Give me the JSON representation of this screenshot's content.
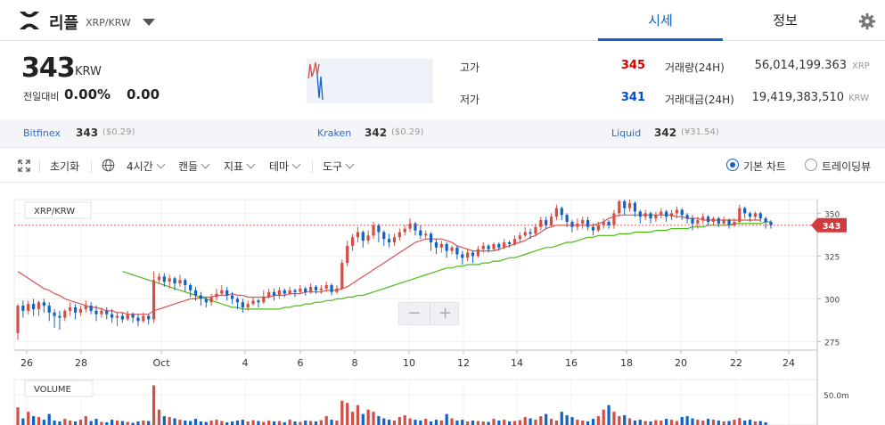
{
  "header": {
    "coin_name": "리플",
    "pair": "XRP/KRW",
    "tabs": [
      {
        "label": "시세"
      },
      {
        "label": "정보"
      }
    ]
  },
  "summary": {
    "price": "343",
    "unit": "KRW",
    "change_label": "전일대비",
    "change_pct": "0.00%",
    "change_value": "0.00",
    "high_label": "고가",
    "high_value": "345",
    "low_label": "저가",
    "low_value": "341",
    "volume_label": "거래량(24H)",
    "volume_value": "56,014,199.363",
    "volume_unit": "XRP",
    "amount_label": "거래대금(24H)",
    "amount_value": "19,419,383,510",
    "amount_unit": "KRW"
  },
  "exchanges": [
    {
      "name": "Bitfinex",
      "price": "343",
      "fx": "($0.29)"
    },
    {
      "name": "Kraken",
      "price": "342",
      "fx": "($0.29)"
    },
    {
      "name": "Liquid",
      "price": "342",
      "fx": "(¥31.54)"
    }
  ],
  "toolbar": {
    "reset": "초기화",
    "interval": "4시간",
    "candle": "캔들",
    "indicator": "지표",
    "theme": "테마",
    "tools": "도구",
    "basic_chart": "기본 차트",
    "tradingview": "트레이딩뷰"
  },
  "colors": {
    "up": "#d24f45",
    "down": "#1261c4",
    "accent": "#1261c4",
    "ma_short": "#d9534f",
    "ma_long": "#4cbb17"
  },
  "icons": [
    "xrp-logo-icon",
    "chevron-down-icon",
    "gear-icon",
    "expand-icon",
    "globe-icon",
    "zoom-out-icon",
    "zoom-in-icon"
  ],
  "chart_data": {
    "type": "candlestick",
    "legend_price": "XRP/KRW",
    "legend_volume": "VOLUME",
    "x_ticks": [
      "26",
      "28",
      "Oct",
      "4",
      "6",
      "8",
      "10",
      "12",
      "14",
      "16",
      "18",
      "20",
      "22",
      "24"
    ],
    "y_ticks": [
      "350",
      "325",
      "300",
      "275"
    ],
    "ylim": [
      270,
      358
    ],
    "volume_tick": "50.0m",
    "last_price_label": "343",
    "ma_short_start": 316,
    "ma_long_start": 316,
    "candles": [
      [
        280,
        296,
        276,
        297
      ],
      [
        296,
        293,
        289,
        299
      ],
      [
        293,
        297,
        291,
        299
      ],
      [
        297,
        294,
        290,
        300
      ],
      [
        294,
        298,
        290,
        299
      ],
      [
        298,
        296,
        292,
        300
      ],
      [
        296,
        292,
        287,
        298
      ],
      [
        292,
        290,
        283,
        294
      ],
      [
        290,
        289,
        282,
        293
      ],
      [
        289,
        293,
        287,
        294
      ],
      [
        293,
        295,
        290,
        298
      ],
      [
        295,
        292,
        288,
        297
      ],
      [
        292,
        294,
        290,
        296
      ],
      [
        294,
        296,
        292,
        299
      ],
      [
        296,
        293,
        291,
        298
      ],
      [
        293,
        291,
        287,
        296
      ],
      [
        291,
        293,
        289,
        295
      ],
      [
        293,
        291,
        288,
        295
      ],
      [
        291,
        289,
        286,
        294
      ],
      [
        289,
        290,
        284,
        292
      ],
      [
        290,
        288,
        286,
        292
      ],
      [
        288,
        291,
        287,
        293
      ],
      [
        291,
        289,
        286,
        292
      ],
      [
        289,
        287,
        284,
        291
      ],
      [
        287,
        290,
        286,
        292
      ],
      [
        290,
        288,
        285,
        291
      ],
      [
        288,
        311,
        286,
        316
      ],
      [
        311,
        313,
        309,
        315
      ],
      [
        313,
        310,
        307,
        315
      ],
      [
        310,
        312,
        306,
        314
      ],
      [
        312,
        309,
        305,
        313
      ],
      [
        309,
        311,
        307,
        314
      ],
      [
        311,
        308,
        304,
        312
      ],
      [
        308,
        305,
        301,
        309
      ],
      [
        305,
        302,
        299,
        307
      ],
      [
        302,
        300,
        296,
        304
      ],
      [
        300,
        298,
        295,
        301
      ],
      [
        298,
        301,
        296,
        303
      ],
      [
        301,
        303,
        299,
        306
      ],
      [
        303,
        305,
        302,
        308
      ],
      [
        305,
        302,
        299,
        307
      ],
      [
        302,
        300,
        297,
        304
      ],
      [
        300,
        298,
        294,
        301
      ],
      [
        298,
        295,
        292,
        300
      ],
      [
        295,
        297,
        293,
        299
      ],
      [
        297,
        299,
        296,
        301
      ],
      [
        299,
        298,
        295,
        300
      ],
      [
        298,
        301,
        297,
        305
      ],
      [
        301,
        304,
        300,
        306
      ],
      [
        304,
        302,
        299,
        306
      ],
      [
        302,
        305,
        300,
        307
      ],
      [
        305,
        303,
        301,
        306
      ],
      [
        303,
        305,
        302,
        307
      ],
      [
        305,
        304,
        301,
        306
      ],
      [
        304,
        306,
        303,
        308
      ],
      [
        306,
        304,
        302,
        307
      ],
      [
        304,
        307,
        303,
        309
      ],
      [
        307,
        305,
        303,
        308
      ],
      [
        305,
        306,
        303,
        308
      ],
      [
        306,
        308,
        304,
        310
      ],
      [
        308,
        304,
        302,
        309
      ],
      [
        304,
        306,
        303,
        308
      ],
      [
        306,
        321,
        305,
        323
      ],
      [
        321,
        331,
        319,
        334
      ],
      [
        331,
        336,
        328,
        338
      ],
      [
        336,
        339,
        333,
        342
      ],
      [
        339,
        334,
        330,
        340
      ],
      [
        334,
        337,
        332,
        340
      ],
      [
        337,
        343,
        335,
        345
      ],
      [
        343,
        339,
        333,
        344
      ],
      [
        339,
        335,
        331,
        340
      ],
      [
        335,
        333,
        330,
        338
      ],
      [
        333,
        336,
        331,
        338
      ],
      [
        336,
        339,
        334,
        341
      ],
      [
        339,
        341,
        337,
        343
      ],
      [
        341,
        344,
        339,
        347
      ],
      [
        344,
        340,
        337,
        345
      ],
      [
        340,
        337,
        335,
        343
      ],
      [
        337,
        338,
        335,
        340
      ],
      [
        338,
        333,
        328,
        339
      ],
      [
        333,
        330,
        326,
        335
      ],
      [
        330,
        332,
        327,
        334
      ],
      [
        332,
        328,
        324,
        333
      ],
      [
        328,
        330,
        326,
        331
      ],
      [
        330,
        326,
        323,
        331
      ],
      [
        326,
        324,
        320,
        328
      ],
      [
        324,
        327,
        322,
        329
      ],
      [
        327,
        325,
        321,
        328
      ],
      [
        325,
        329,
        324,
        331
      ],
      [
        329,
        331,
        327,
        333
      ],
      [
        331,
        329,
        327,
        332
      ],
      [
        329,
        332,
        328,
        333
      ],
      [
        332,
        330,
        328,
        333
      ],
      [
        330,
        333,
        329,
        335
      ],
      [
        333,
        332,
        330,
        334
      ],
      [
        332,
        335,
        331,
        337
      ],
      [
        335,
        337,
        333,
        339
      ],
      [
        337,
        339,
        336,
        342
      ],
      [
        339,
        338,
        335,
        341
      ],
      [
        338,
        342,
        337,
        344
      ],
      [
        342,
        346,
        340,
        348
      ],
      [
        346,
        343,
        341,
        348
      ],
      [
        343,
        348,
        342,
        350
      ],
      [
        348,
        353,
        346,
        355
      ],
      [
        353,
        349,
        346,
        354
      ],
      [
        349,
        345,
        342,
        350
      ],
      [
        345,
        342,
        339,
        346
      ],
      [
        342,
        344,
        340,
        347
      ],
      [
        344,
        346,
        341,
        348
      ],
      [
        346,
        342,
        340,
        348
      ],
      [
        342,
        340,
        337,
        344
      ],
      [
        340,
        343,
        339,
        345
      ],
      [
        343,
        345,
        341,
        347
      ],
      [
        345,
        343,
        341,
        346
      ],
      [
        343,
        350,
        341,
        352
      ],
      [
        350,
        357,
        348,
        358
      ],
      [
        357,
        353,
        349,
        358
      ],
      [
        353,
        356,
        351,
        358
      ],
      [
        356,
        351,
        348,
        357
      ],
      [
        351,
        348,
        344,
        352
      ],
      [
        348,
        350,
        346,
        352
      ],
      [
        350,
        347,
        344,
        351
      ],
      [
        347,
        349,
        345,
        351
      ],
      [
        349,
        351,
        347,
        353
      ],
      [
        351,
        348,
        345,
        352
      ],
      [
        348,
        350,
        346,
        352
      ],
      [
        350,
        352,
        347,
        354
      ],
      [
        352,
        349,
        346,
        353
      ],
      [
        349,
        347,
        344,
        350
      ],
      [
        347,
        344,
        340,
        349
      ],
      [
        344,
        346,
        341,
        348
      ],
      [
        346,
        348,
        344,
        350
      ],
      [
        348,
        345,
        343,
        349
      ],
      [
        345,
        347,
        343,
        348
      ],
      [
        347,
        344,
        342,
        348
      ],
      [
        344,
        346,
        343,
        348
      ],
      [
        346,
        343,
        341,
        347
      ],
      [
        343,
        345,
        342,
        347
      ],
      [
        345,
        353,
        344,
        355
      ],
      [
        353,
        350,
        347,
        354
      ],
      [
        350,
        348,
        345,
        351
      ],
      [
        348,
        350,
        346,
        351
      ],
      [
        350,
        347,
        345,
        351
      ],
      [
        347,
        345,
        341,
        348
      ],
      [
        345,
        343,
        341,
        346
      ]
    ],
    "ma_short": [
      316,
      314,
      312,
      310,
      308,
      306,
      305,
      303,
      302,
      300,
      299,
      298,
      297,
      296,
      295,
      295,
      294,
      293,
      293,
      292,
      292,
      291,
      291,
      291,
      291,
      291,
      293,
      294,
      295,
      296,
      297,
      298,
      299,
      300,
      300,
      301,
      301,
      301,
      302,
      302,
      302,
      303,
      302,
      302,
      301,
      301,
      301,
      301,
      301,
      302,
      302,
      302,
      303,
      303,
      303,
      304,
      304,
      304,
      304,
      305,
      305,
      305,
      306,
      307,
      309,
      311,
      313,
      315,
      317,
      319,
      321,
      323,
      325,
      327,
      329,
      331,
      333,
      334,
      335,
      335,
      335,
      335,
      334,
      333,
      331,
      330,
      329,
      328,
      328,
      328,
      328,
      328,
      329,
      330,
      331,
      332,
      333,
      334,
      336,
      337,
      339,
      341,
      342,
      343,
      343,
      343,
      343,
      343,
      343,
      343,
      343,
      344,
      345,
      347,
      348,
      349,
      349,
      349,
      349,
      349,
      349,
      349,
      349,
      349,
      349,
      349,
      348,
      348,
      347,
      347,
      347,
      346,
      346,
      346,
      346,
      346,
      346,
      346,
      346,
      346,
      346,
      346,
      346
    ],
    "ma_long": [
      316,
      315,
      314,
      313,
      312,
      311,
      310,
      309,
      308,
      307,
      306,
      305,
      304,
      303,
      302,
      301,
      300,
      299,
      298,
      297,
      296,
      295,
      295,
      294,
      294,
      294,
      294,
      294,
      294,
      294,
      294,
      295,
      295,
      296,
      296,
      297,
      297,
      298,
      298,
      299,
      299,
      300,
      300,
      301,
      301,
      302,
      302,
      303,
      304,
      305,
      306,
      307,
      308,
      309,
      310,
      311,
      312,
      313,
      314,
      315,
      316,
      317,
      318,
      318,
      319,
      319,
      320,
      320,
      320,
      321,
      321,
      322,
      322,
      323,
      324,
      324,
      325,
      326,
      327,
      328,
      329,
      330,
      330,
      331,
      332,
      333,
      333,
      334,
      335,
      336,
      336,
      337,
      337,
      337,
      337,
      338,
      338,
      338,
      339,
      339,
      339,
      339,
      340,
      340,
      340,
      341,
      341,
      341,
      341,
      342,
      342,
      342,
      343,
      343,
      343,
      343,
      343,
      344,
      344,
      344,
      344,
      344,
      344,
      345,
      345,
      345,
      345,
      345,
      345,
      345,
      345,
      345,
      345,
      345,
      345,
      345,
      345,
      345,
      345,
      345,
      345,
      345,
      345,
      345,
      345,
      345,
      345,
      345
    ],
    "volume": [
      40,
      15,
      30,
      20,
      18,
      12,
      25,
      10,
      8,
      14,
      10,
      8,
      12,
      20,
      9,
      14,
      7,
      6,
      12,
      10,
      9,
      7,
      5,
      8,
      10,
      9,
      90,
      35,
      20,
      18,
      15,
      12,
      10,
      9,
      14,
      8,
      7,
      10,
      12,
      9,
      6,
      8,
      10,
      12,
      8,
      11,
      9,
      7,
      10,
      8,
      9,
      6,
      12,
      8,
      7,
      10,
      9,
      8,
      11,
      20,
      12,
      10,
      55,
      50,
      30,
      45,
      25,
      35,
      30,
      20,
      15,
      12,
      10,
      18,
      22,
      15,
      12,
      10,
      14,
      8,
      12,
      10,
      25,
      15,
      10,
      12,
      8,
      10,
      9,
      8,
      7,
      14,
      10,
      12,
      8,
      9,
      11,
      18,
      15,
      12,
      20,
      25,
      14,
      10,
      30,
      22,
      18,
      12,
      10,
      8,
      14,
      20,
      35,
      45,
      30,
      20,
      22,
      15,
      10,
      12,
      9,
      8,
      11,
      10,
      14,
      12,
      9,
      18,
      20,
      15,
      12,
      10,
      14,
      12,
      10,
      8,
      9,
      12,
      16,
      10,
      12,
      8,
      9,
      6
    ]
  }
}
